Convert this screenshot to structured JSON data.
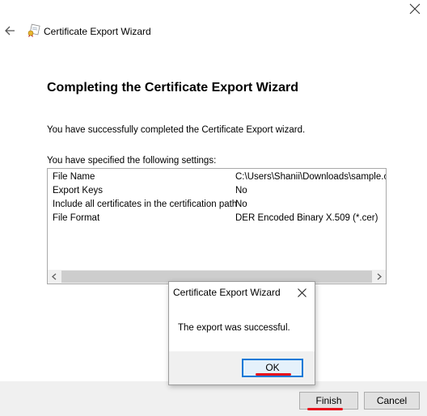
{
  "window": {
    "title": "Certificate Export Wizard"
  },
  "main": {
    "heading": "Completing the Certificate Export Wizard",
    "success_text": "You have successfully completed the Certificate Export wizard.",
    "settings_label": "You have specified the following settings:",
    "settings": [
      {
        "key": "File Name",
        "value": "C:\\Users\\Shanii\\Downloads\\sample.cer"
      },
      {
        "key": "Export Keys",
        "value": "No"
      },
      {
        "key": "Include all certificates in the certification path",
        "value": "No"
      },
      {
        "key": "File Format",
        "value": "DER Encoded Binary X.509 (*.cer)"
      }
    ]
  },
  "footer": {
    "finish_label": "Finish",
    "cancel_label": "Cancel"
  },
  "dialog": {
    "title": "Certificate Export Wizard",
    "message": "The export was successful.",
    "ok_label": "OK"
  },
  "colors": {
    "annotation_red": "#e8101c",
    "focus_blue": "#0078d7"
  }
}
